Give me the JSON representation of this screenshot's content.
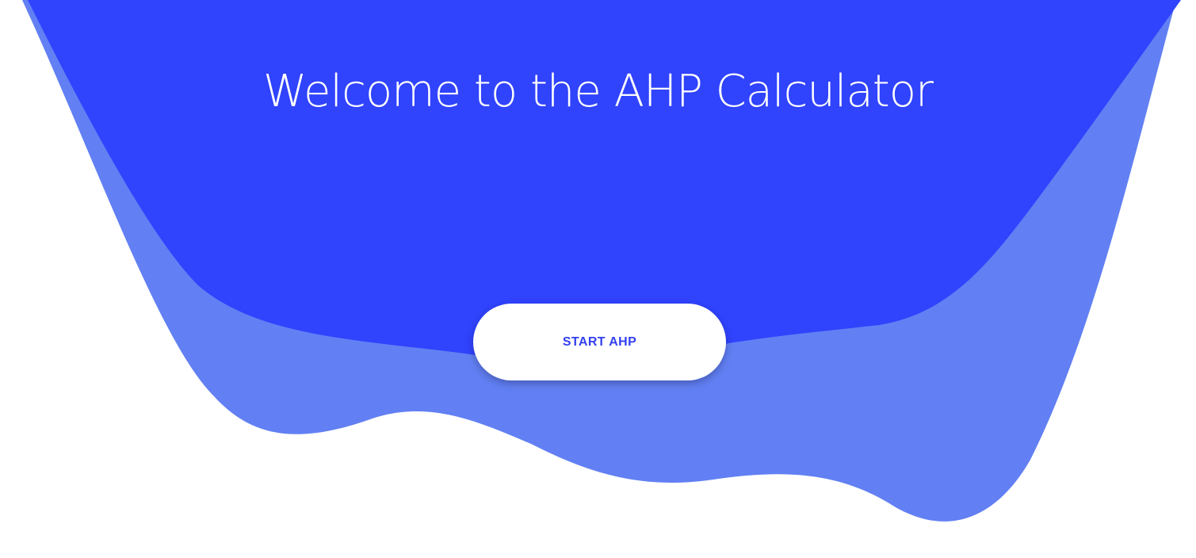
{
  "hero": {
    "title": "Welcome to the AHP Calculator",
    "cta_label": "START AHP"
  },
  "colors": {
    "primary_wave": "#3043fd",
    "secondary_wave": "#6280f3",
    "background": "#ffffff",
    "button_text": "#3340f0"
  }
}
